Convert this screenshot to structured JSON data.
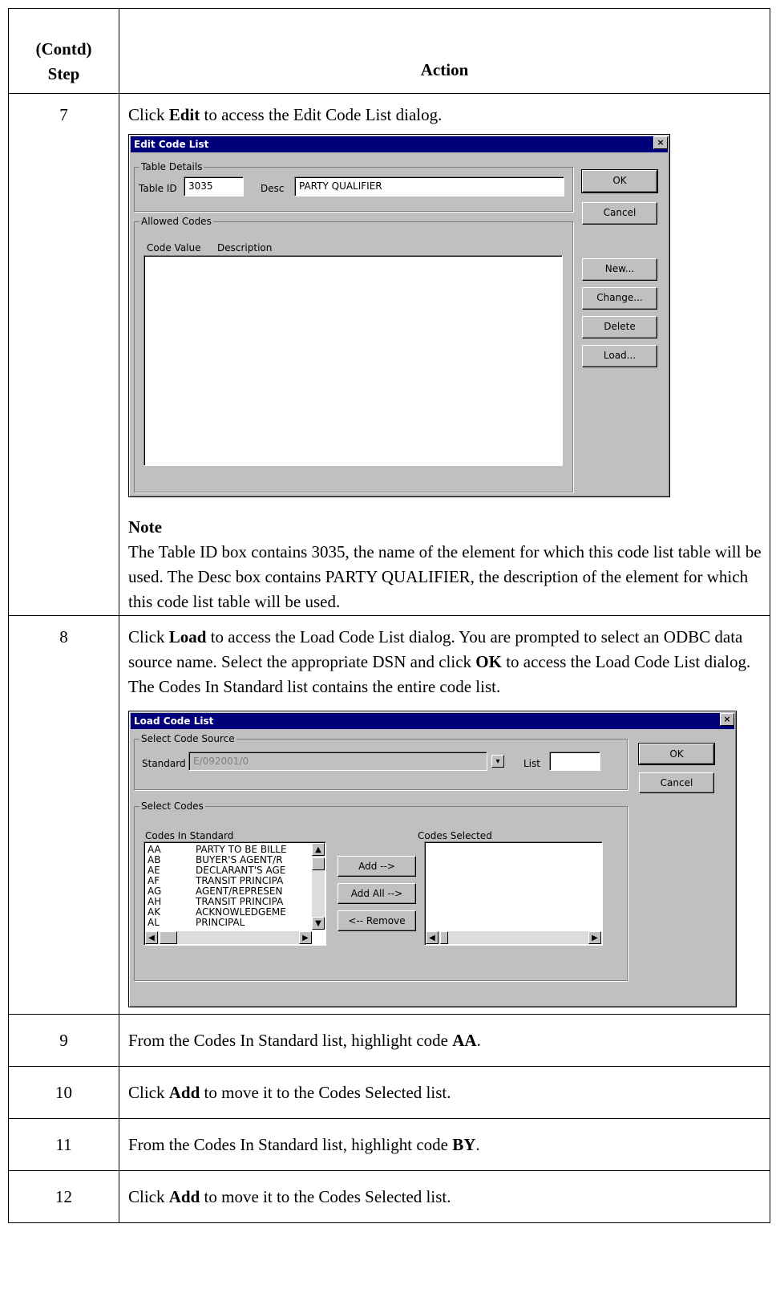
{
  "header": {
    "step_label_1": "(Contd)",
    "step_label_2": "Step",
    "action_label": "Action"
  },
  "steps": [
    {
      "num": "7",
      "pre": "Click ",
      "bold": "Edit",
      "post": " to access the Edit Code List dialog."
    },
    {
      "num": "8",
      "pre": "Click ",
      "bold": "Load",
      "mid": " to access the Load Code List dialog. You are prompted to select an ODBC data source name. Select the appropriate DSN and click ",
      "bold2": "OK",
      "post": " to access the Load Code List dialog. The Codes In Standard list contains the entire code list."
    },
    {
      "num": "9",
      "pre": "From the Codes In Standard list, highlight code ",
      "bold": "AA",
      "post": "."
    },
    {
      "num": "10",
      "pre": "Click ",
      "bold": "Add",
      "post": " to move it to the Codes Selected list."
    },
    {
      "num": "11",
      "pre": "From the Codes In Standard list, highlight code ",
      "bold": "BY",
      "post": "."
    },
    {
      "num": "12",
      "pre": "Click ",
      "bold": "Add",
      "post": " to move it to the Codes Selected list."
    }
  ],
  "note": {
    "heading": "Note",
    "text": "The Table ID box contains 3035, the name of the element for which this code list table will be used. The Desc box contains PARTY QUALIFIER, the description of the element for which this code list table will be used."
  },
  "edit_dialog": {
    "title": "Edit Code List",
    "close": "×",
    "table_details": "Table Details",
    "table_id_label": "Table ID",
    "table_id_value": "3035",
    "desc_label": "Desc",
    "desc_value": "PARTY QUALIFIER",
    "allowed_codes": "Allowed Codes",
    "col_code_value": "Code Value",
    "col_description": "Description",
    "ok": "OK",
    "cancel": "Cancel",
    "new": "New...",
    "change": "Change...",
    "delete": "Delete",
    "load": "Load..."
  },
  "load_dialog": {
    "title": "Load Code List",
    "close": "×",
    "select_code_source": "Select Code Source",
    "standard_label": "Standard",
    "standard_value": "E/092001/0",
    "list_label": "List",
    "list_value": "",
    "ok": "OK",
    "cancel": "Cancel",
    "select_codes": "Select Codes",
    "codes_in_standard": "Codes In Standard",
    "codes_selected": "Codes Selected",
    "add": "Add -->",
    "add_all": "Add All -->",
    "remove": "<-- Remove",
    "codes": [
      {
        "code": "AA",
        "desc": "PARTY TO BE BILLE"
      },
      {
        "code": "AB",
        "desc": "BUYER'S AGENT/R"
      },
      {
        "code": "AE",
        "desc": "DECLARANT'S AGE"
      },
      {
        "code": "AF",
        "desc": "TRANSIT PRINCIPA"
      },
      {
        "code": "AG",
        "desc": "AGENT/REPRESEN"
      },
      {
        "code": "AH",
        "desc": "TRANSIT PRINCIPA"
      },
      {
        "code": "AK",
        "desc": "ACKNOWLEDGEME"
      },
      {
        "code": "AL",
        "desc": "PRINCIPAL"
      }
    ]
  }
}
